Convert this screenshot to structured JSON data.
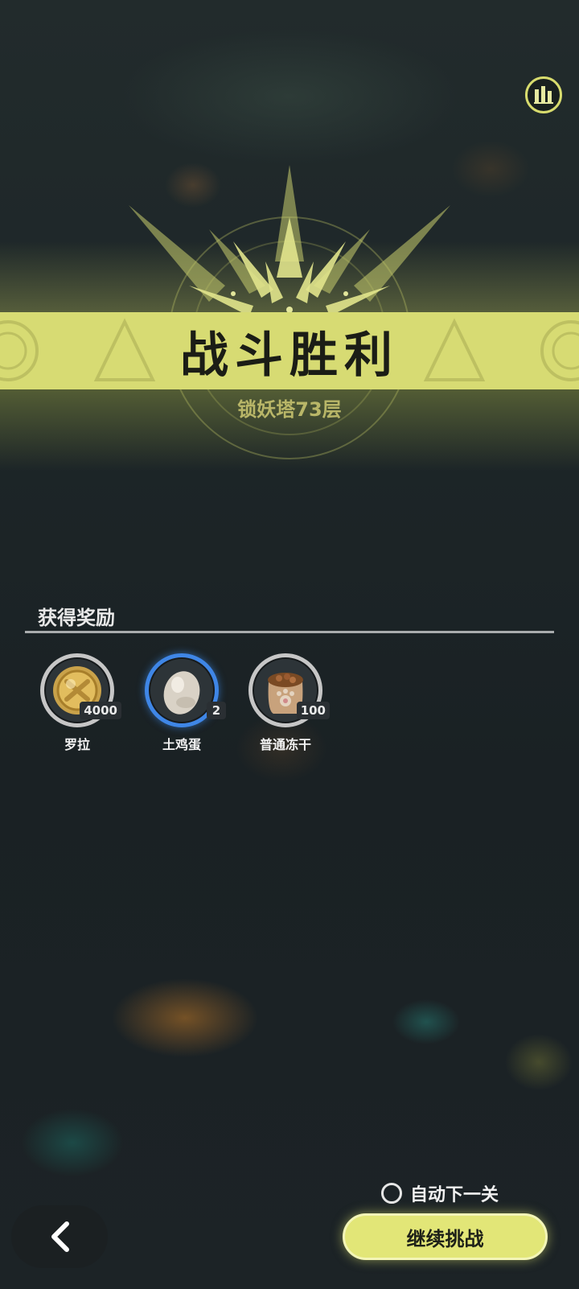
{
  "result": {
    "title": "战斗胜利",
    "stage": "锁妖塔73层"
  },
  "rewards": {
    "header": "获得奖励",
    "items": [
      {
        "name": "罗拉",
        "quantity": "4000",
        "icon": "gold-coin-icon"
      },
      {
        "name": "土鸡蛋",
        "quantity": "2",
        "icon": "egg-icon"
      },
      {
        "name": "普通冻干",
        "quantity": "100",
        "icon": "treat-bag-icon"
      }
    ]
  },
  "controls": {
    "auto_next_label": "自动下一关",
    "auto_next_checked": false,
    "continue_label": "继续挑战",
    "back_icon": "chevron-left-icon",
    "stats_icon": "bar-chart-icon"
  },
  "colors": {
    "accent": "#d7db73",
    "button": "#e2e677",
    "rare_border": "#3f86e6"
  }
}
